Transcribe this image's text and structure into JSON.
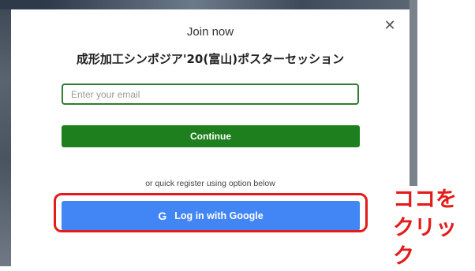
{
  "modal": {
    "title": "Join now",
    "event_name": "成形加工シンポジア'20(富山)ポスターセッション",
    "close_symbol": "✕",
    "email_placeholder": "Enter your email",
    "email_value": "",
    "continue_label": "Continue",
    "or_text": "or quick register using option below",
    "google_label": "Log in with Google",
    "google_icon_glyph": "G"
  },
  "annotation": {
    "line1": "ココを",
    "line2": "クリック",
    "color": "#e31b1b"
  },
  "colors": {
    "continue_green": "#1e7f1e",
    "google_blue": "#4285f4",
    "input_border": "#2e7d32"
  }
}
